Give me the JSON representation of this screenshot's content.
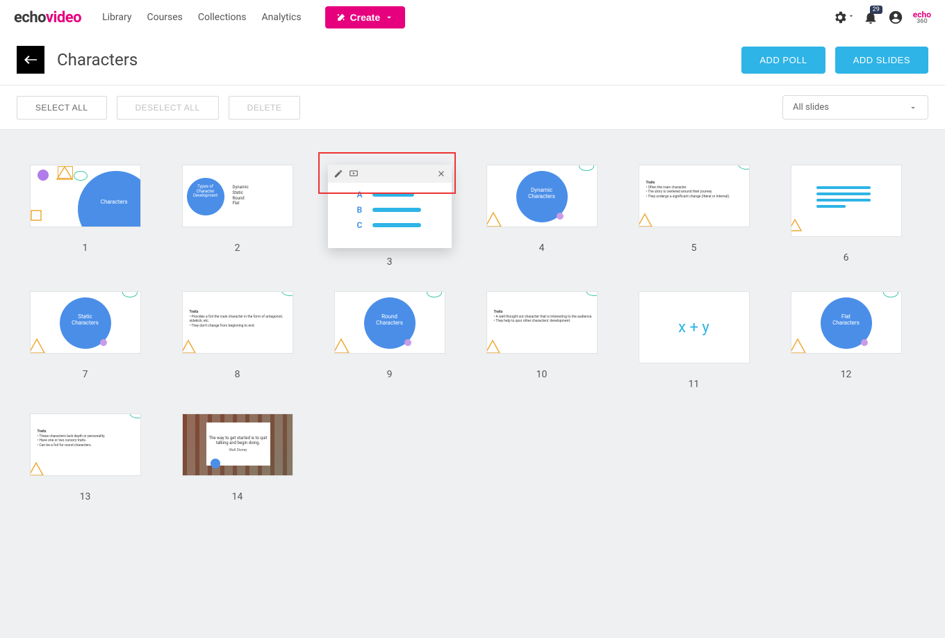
{
  "brand": {
    "part1": "echo",
    "part2": "video"
  },
  "nav": {
    "links": [
      "Library",
      "Courses",
      "Collections",
      "Analytics"
    ],
    "create": "Create",
    "notifications_count": "29"
  },
  "logo360": {
    "top": "echo",
    "bot": "360"
  },
  "page": {
    "title": "Characters",
    "add_poll": "ADD POLL",
    "add_slides": "ADD SLIDES"
  },
  "toolbar": {
    "select_all": "SELECT ALL",
    "deselect_all": "DESELECT ALL",
    "delete": "DELETE",
    "filter": "All slides"
  },
  "slides": [
    {
      "num": "1",
      "kind": "title",
      "title": "Characters"
    },
    {
      "num": "2",
      "kind": "circle-list",
      "title": "Types of Character Development",
      "list": [
        "Dynamic",
        "Static",
        "Round",
        "Flat"
      ]
    },
    {
      "num": "3",
      "kind": "poll",
      "options": [
        "A",
        "B",
        "C"
      ]
    },
    {
      "num": "4",
      "kind": "big-circle",
      "title": "Dynamic Characters"
    },
    {
      "num": "5",
      "kind": "traits",
      "heading": "Traits",
      "bullets": [
        "Often the main character.",
        "The story is centered around their journey.",
        "They undergo a significant change (literal or internal)."
      ]
    },
    {
      "num": "6",
      "kind": "lines"
    },
    {
      "num": "7",
      "kind": "big-circle",
      "title": "Static Characters"
    },
    {
      "num": "8",
      "kind": "traits",
      "heading": "Traits",
      "bullets": [
        "Provides a foil the main character in the form of antagonist, sidekick, etc.",
        "They don't change from beginning to end."
      ]
    },
    {
      "num": "9",
      "kind": "big-circle",
      "title": "Round Characters"
    },
    {
      "num": "10",
      "kind": "traits",
      "heading": "Traits",
      "bullets": [
        "A well thought out character that is interesting to the audience.",
        "They help to spur other characters' development."
      ]
    },
    {
      "num": "11",
      "kind": "formula",
      "text": "x + y"
    },
    {
      "num": "12",
      "kind": "big-circle",
      "title": "Flat Characters"
    },
    {
      "num": "13",
      "kind": "traits",
      "heading": "Traits",
      "bullets": [
        "These characters lack depth or personality.",
        "Have one or two cursory traits.",
        "Can be a foil for round characters."
      ]
    },
    {
      "num": "14",
      "kind": "quote",
      "text": "The way to get started is to quit talking and begin doing.",
      "author": "Walt Disney"
    }
  ]
}
